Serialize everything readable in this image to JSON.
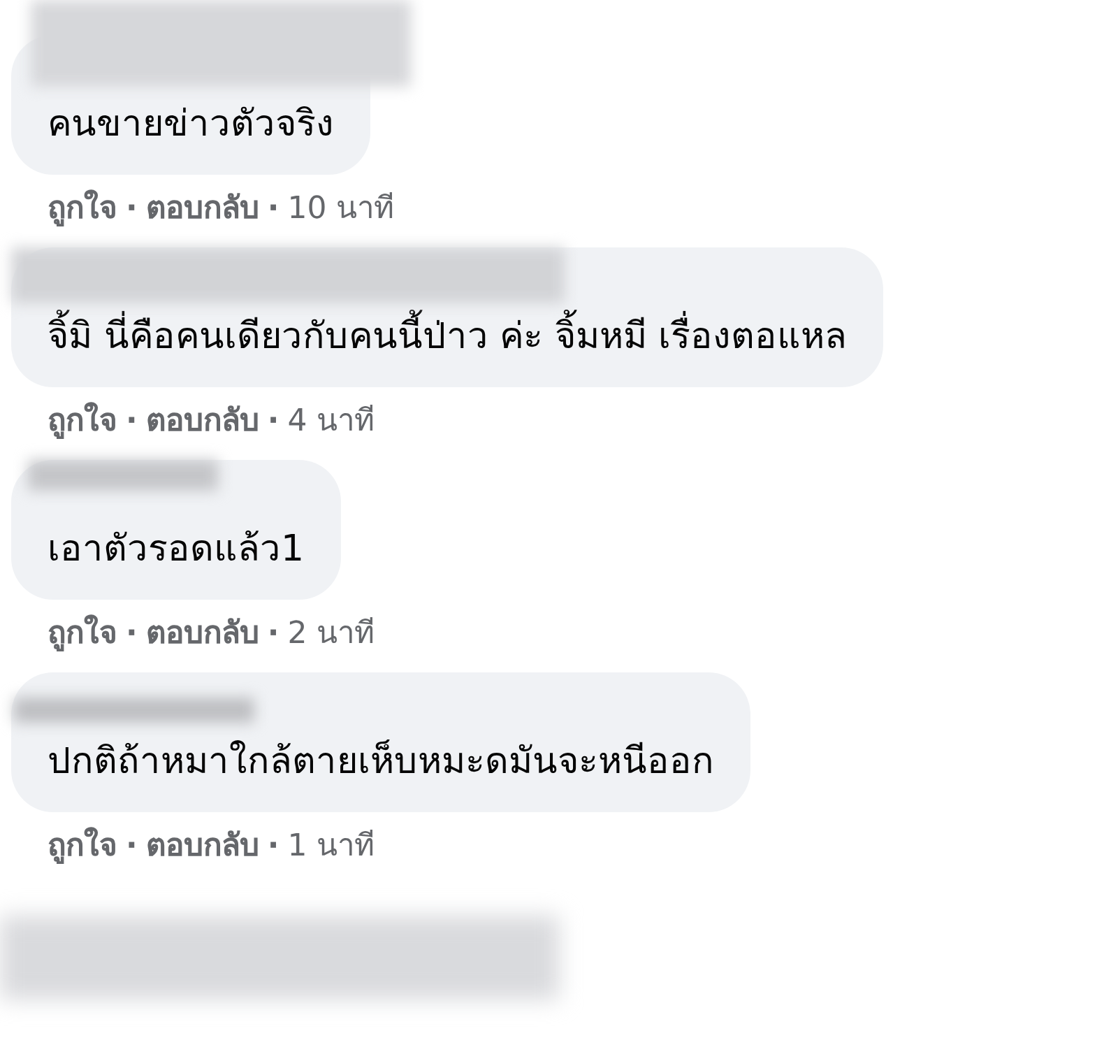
{
  "comments": [
    {
      "name_hidden": true,
      "text": "คนขายข่าวตัวจริง",
      "actions": [
        "ถูกใจ",
        "ตอบกลับ"
      ],
      "time": "10 นาที"
    },
    {
      "name_hidden": true,
      "text": "จิ้มิ นี่คือคนเดียวกับคนนี้ป่าว ค่ะ จิ้มหมี เรื่องตอแหล",
      "actions": [
        "ถูกใจ",
        "ตอบกลับ"
      ],
      "time": "4 นาที"
    },
    {
      "name_hidden": true,
      "text": "เอาตัวรอดแล้ว1",
      "actions": [
        "ถูกใจ",
        "ตอบกลับ"
      ],
      "time": "2 นาที"
    },
    {
      "name_hidden": true,
      "text": "ปกติถ้าหมาใกล้ตายเห็บหมะดมันจะหนีออก",
      "actions": [
        "ถูกใจ",
        "ตอบกลับ"
      ],
      "time": "1 นาที"
    }
  ],
  "separator": "·",
  "more_hidden": true
}
